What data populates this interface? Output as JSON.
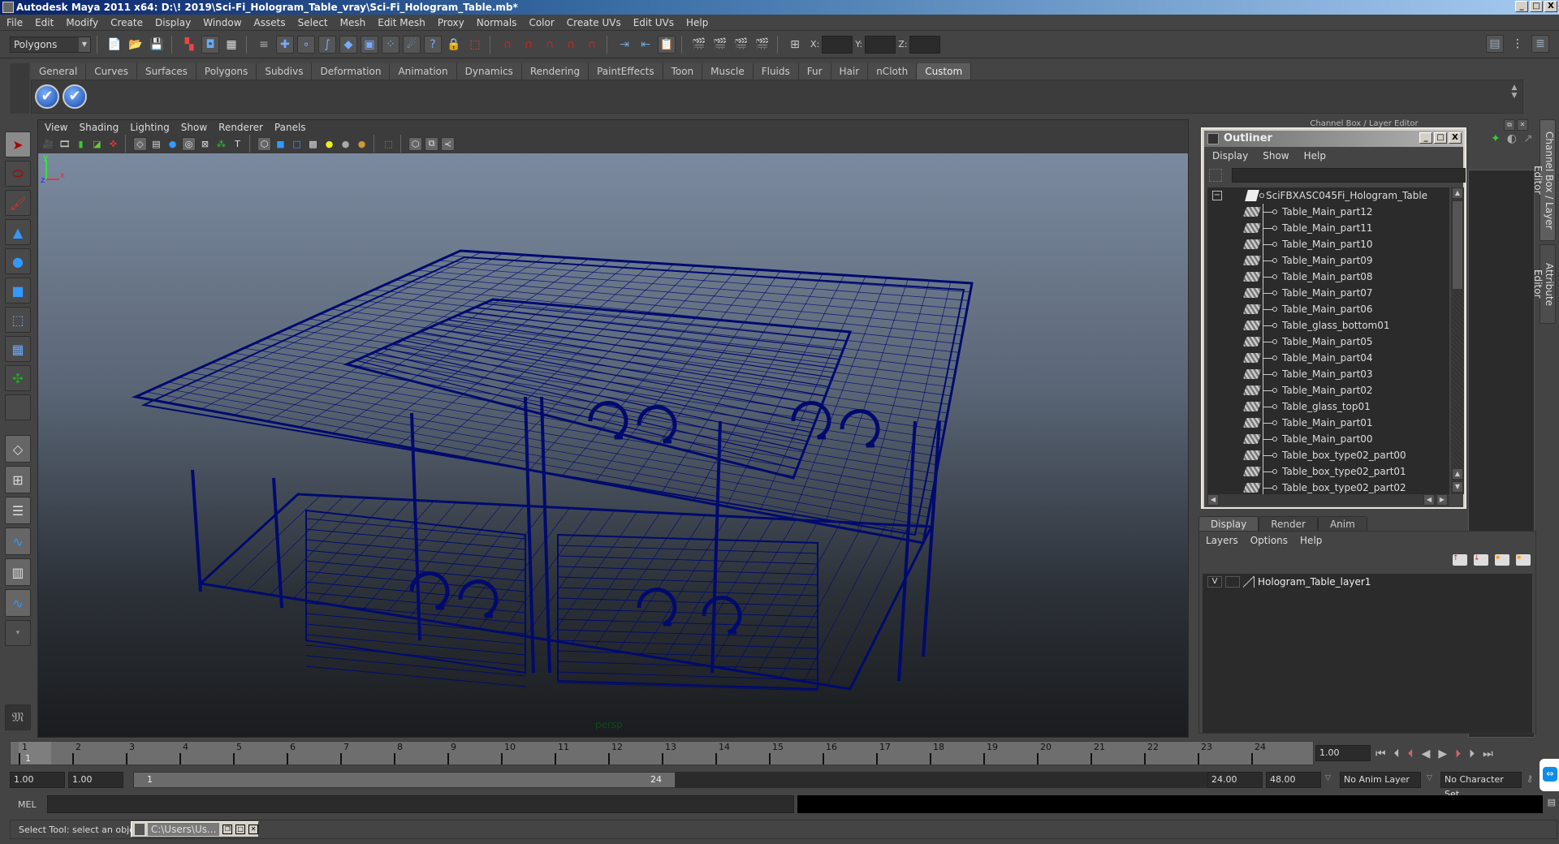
{
  "window": {
    "title": "Autodesk Maya 2011 x64: D:\\! 2019\\Sci-Fi_Hologram_Table_vray\\Sci-Fi_Hologram_Table.mb*",
    "minimize": "_",
    "maximize": "□",
    "close": "X"
  },
  "menubar": [
    "File",
    "Edit",
    "Modify",
    "Create",
    "Display",
    "Window",
    "Assets",
    "Select",
    "Mesh",
    "Edit Mesh",
    "Proxy",
    "Normals",
    "Color",
    "Create UVs",
    "Edit UVs",
    "Help"
  ],
  "statusline": {
    "mode": "Polygons",
    "coords": {
      "x_label": "X:",
      "y_label": "Y:",
      "z_label": "Z:",
      "x": "",
      "y": "",
      "z": ""
    },
    "icons": [
      "new-scene",
      "open-scene",
      "save-scene",
      "select-by-hierarchy",
      "select-by-object",
      "select-by-component",
      "snap-grid",
      "snap-curve",
      "snap-point",
      "snap-view-plane",
      "make-live",
      "history",
      "lock",
      "render-region",
      "render",
      "ipr-render",
      "render-settings",
      "hypershade",
      "input-line",
      "show-hide-channel-box",
      "show-hide-tool-settings",
      "show-hide-attribute-editor"
    ]
  },
  "shelf": {
    "tabs": [
      "General",
      "Curves",
      "Surfaces",
      "Polygons",
      "Subdivs",
      "Deformation",
      "Animation",
      "Dynamics",
      "Rendering",
      "PaintEffects",
      "Toon",
      "Muscle",
      "Fluids",
      "Fur",
      "Hair",
      "nCloth",
      "Custom"
    ],
    "active_tab": "Custom",
    "buttons": [
      "✔",
      "✔"
    ]
  },
  "toolbox": [
    "select-tool",
    "lasso-tool",
    "paint-select-tool",
    "move-tool",
    "rotate-tool",
    "scale-tool",
    "universal-manipulator",
    "soft-modification-tool",
    "show-manipulator",
    "last-tool"
  ],
  "layouts": [
    "single-perspective",
    "four-view",
    "outliner-persp",
    "persp-graph",
    "hypershade-persp",
    "persp-graph-hypergraph"
  ],
  "viewport": {
    "menu": [
      "View",
      "Shading",
      "Lighting",
      "Show",
      "Renderer",
      "Panels"
    ],
    "camera_label": "persp",
    "axes": {
      "y": "y",
      "x": "x",
      "z": "z"
    },
    "wireframe_color": "#000a6e"
  },
  "channelbox": {
    "header": "Channel Box / Layer Editor",
    "side_tabs": [
      "Channel Box / Layer Editor",
      "Attribute Editor"
    ]
  },
  "outliner": {
    "title": "Outliner",
    "menu": [
      "Display",
      "Show",
      "Help"
    ],
    "root": "SciFBXASC045Fi_Hologram_Table",
    "items": [
      "Table_Main_part12",
      "Table_Main_part11",
      "Table_Main_part10",
      "Table_Main_part09",
      "Table_Main_part08",
      "Table_Main_part07",
      "Table_Main_part06",
      "Table_glass_bottom01",
      "Table_Main_part05",
      "Table_Main_part04",
      "Table_Main_part03",
      "Table_Main_part02",
      "Table_glass_top01",
      "Table_Main_part01",
      "Table_Main_part00",
      "Table_box_type02_part00",
      "Table_box_type02_part01",
      "Table_box_type02_part02"
    ]
  },
  "layer_editor": {
    "tabs": [
      "Display",
      "Render",
      "Anim"
    ],
    "active_tab": "Display",
    "menu": [
      "Layers",
      "Options",
      "Help"
    ],
    "layers": [
      {
        "visible": "V",
        "name": "Hologram_Table_layer1"
      }
    ]
  },
  "timeline": {
    "ticks": [
      "1",
      "2",
      "3",
      "4",
      "5",
      "6",
      "7",
      "8",
      "9",
      "10",
      "11",
      "12",
      "13",
      "14",
      "15",
      "16",
      "17",
      "18",
      "19",
      "20",
      "21",
      "22",
      "23",
      "24"
    ],
    "current_frame_marker": "1",
    "current_time": "1.00"
  },
  "range": {
    "start_time": "1.00",
    "playback_start": "1.00",
    "slider_start": "1",
    "slider_end": "24",
    "playback_end": "24.00",
    "end_time": "48.00",
    "anim_layer": "No Anim Layer",
    "character_set": "No Character Set"
  },
  "command": {
    "label": "MEL",
    "value": ""
  },
  "helpline": {
    "text": "Select Tool: select an object",
    "task_button": "C:\\Users\\Us..."
  }
}
